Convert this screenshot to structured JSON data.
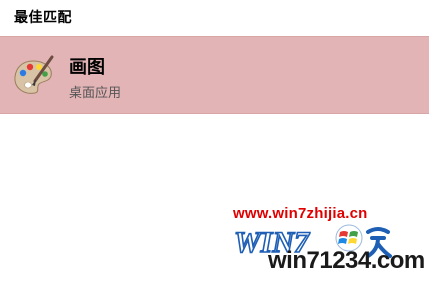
{
  "best_match": {
    "heading": "最佳匹配"
  },
  "result": {
    "icon": "paint-palette-icon",
    "name": "画图",
    "type": "桌面应用",
    "highlight_color": "#e2b4b6"
  },
  "watermark": {
    "url": "www.win7zhijia.cn",
    "logo_text": "WIN7",
    "domain": "win71234.com",
    "accent_color": "#e00000"
  }
}
